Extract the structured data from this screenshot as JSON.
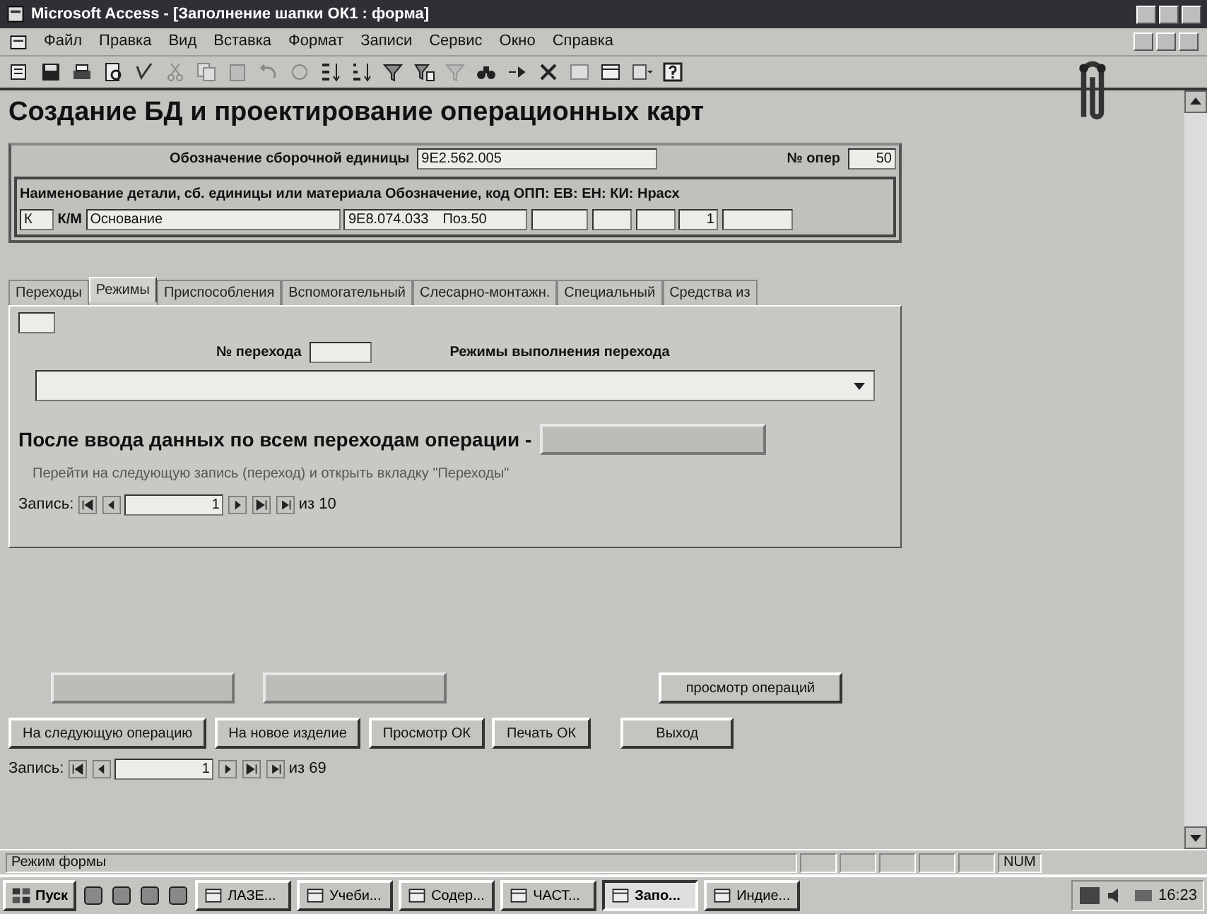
{
  "window": {
    "title": "Microsoft Access - [Заполнение шапки ОК1 : форма]"
  },
  "menu": [
    "Файл",
    "Правка",
    "Вид",
    "Вставка",
    "Формат",
    "Записи",
    "Сервис",
    "Окно",
    "Справка"
  ],
  "form_title": "Создание БД и проектирование операционных карт",
  "assembly": {
    "label": "Обозначение сборочной единицы",
    "value": "9Е2.562.005",
    "op_label": "№ опер",
    "op_value": "50"
  },
  "part": {
    "headers": [
      "Наименование детали, сб. единицы или материала",
      "Обозначение, код",
      "ОПП:",
      "ЕВ:",
      "ЕН:",
      "КИ:",
      "Нрасх"
    ],
    "kind_value": "К",
    "km_label": "К/М",
    "name_value": "Основание",
    "code_value": "9Е8.074.033",
    "pos_value": "Поз.50",
    "ki_value": "1"
  },
  "tabs": [
    {
      "label": "Переходы",
      "selected": false
    },
    {
      "label": "Режимы",
      "selected": true
    },
    {
      "label": "Приспособления",
      "selected": false
    },
    {
      "label": "Вспомогательный",
      "selected": false
    },
    {
      "label": "Слесарно-монтажн.",
      "selected": false
    },
    {
      "label": "Специальный",
      "selected": false
    },
    {
      "label": "Средства из",
      "selected": false
    }
  ],
  "modes": {
    "step_label": "№ перехода",
    "modes_label": "Режимы выполнения перехода",
    "after_label": "После ввода данных по всем переходам операции -",
    "hint": "Перейти на следующую запись (переход) и открыть вкладку \"Переходы\""
  },
  "sub_nav": {
    "label": "Запись:",
    "current": "1",
    "total": "из 10"
  },
  "buttons_row1": [
    {
      "disabled": true
    },
    {
      "disabled": true
    },
    {
      "label": "просмотр операций",
      "disabled": false
    }
  ],
  "buttons_row2": [
    {
      "label": "На следующую операцию",
      "disabled": false
    },
    {
      "label": "На новое изделие",
      "disabled": false
    },
    {
      "label": "Просмотр ОК",
      "disabled": false
    },
    {
      "label": "Печать ОК",
      "disabled": false
    },
    {
      "label": "Выход",
      "disabled": false
    }
  ],
  "main_nav": {
    "label": "Запись:",
    "current": "1",
    "total": "из 69"
  },
  "status_bar": {
    "text": "Режим формы",
    "indicator": "NUM"
  },
  "taskbar": {
    "start": "Пуск",
    "tasks": [
      {
        "label": "ЛАЗЕ...",
        "selected": false
      },
      {
        "label": "Учеби...",
        "selected": false
      },
      {
        "label": "Содер...",
        "selected": false
      },
      {
        "label": "ЧАСТ...",
        "selected": false
      },
      {
        "label": "Запо...",
        "selected": true
      },
      {
        "label": "Индие...",
        "selected": false
      }
    ],
    "clock": "16:23"
  }
}
